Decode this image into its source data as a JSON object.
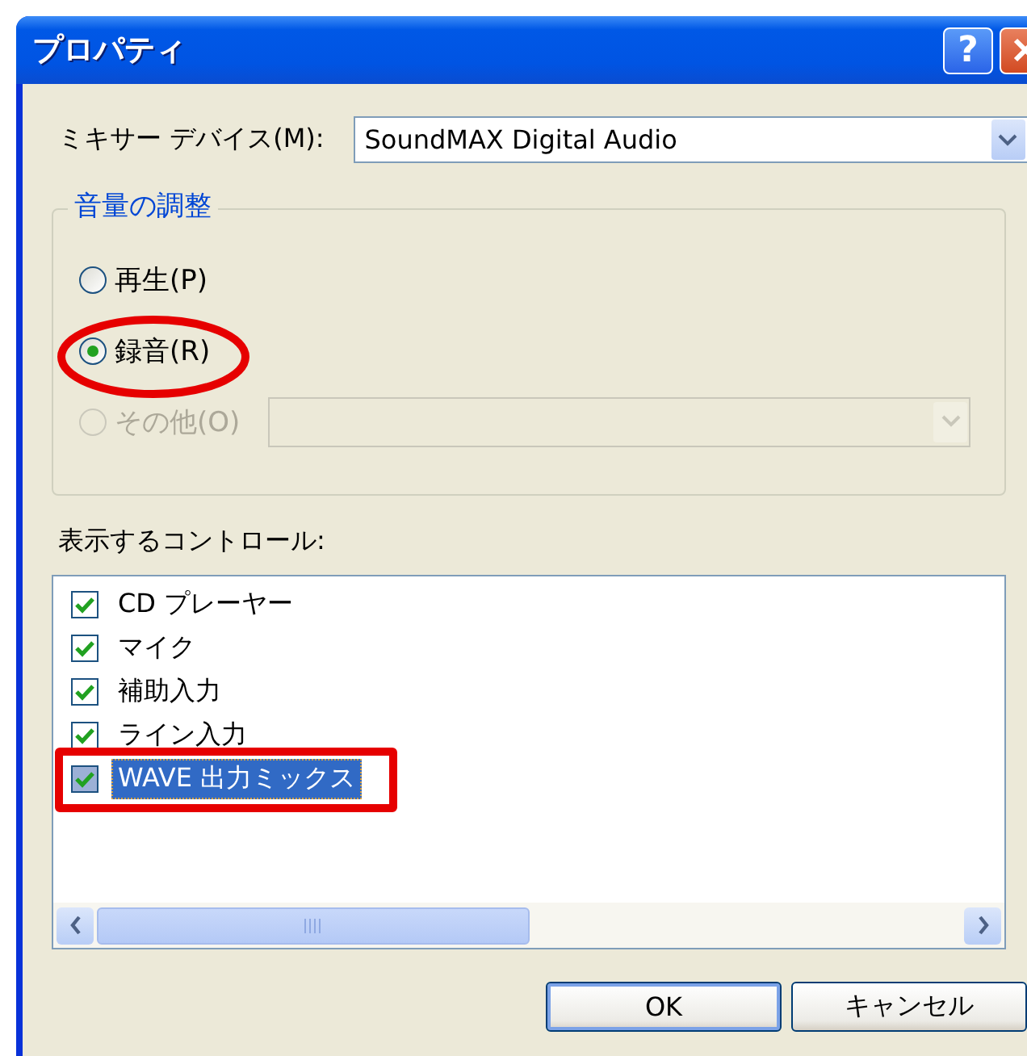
{
  "window": {
    "title": "プロパティ",
    "help_button": "?"
  },
  "mixer_device": {
    "label": "ミキサー デバイス(M):",
    "value": "SoundMAX Digital Audio"
  },
  "volume_group": {
    "title": "音量の調整",
    "options": [
      {
        "label": "再生(P)",
        "selected": false,
        "disabled": false
      },
      {
        "label": "録音(R)",
        "selected": true,
        "disabled": false,
        "circled": true
      },
      {
        "label": "その他(O)",
        "selected": false,
        "disabled": true
      }
    ]
  },
  "controls": {
    "label": "表示するコントロール:",
    "items": [
      {
        "label": "CD プレーヤー",
        "checked": true,
        "selected": false
      },
      {
        "label": "マイク",
        "checked": true,
        "selected": false
      },
      {
        "label": "補助入力",
        "checked": true,
        "selected": false
      },
      {
        "label": "ライン入力",
        "checked": true,
        "selected": false
      },
      {
        "label": "WAVE 出力ミックス",
        "checked": true,
        "selected": true,
        "boxed": true
      }
    ]
  },
  "buttons": [
    "OK",
    "キャンセル"
  ]
}
